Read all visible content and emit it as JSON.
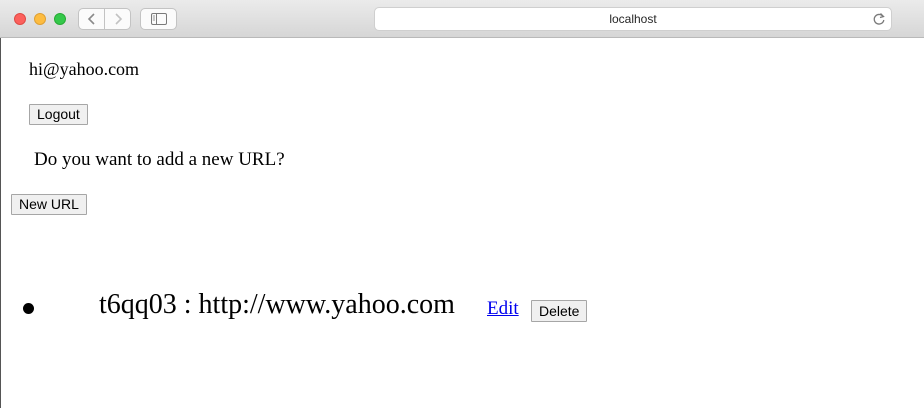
{
  "browser": {
    "address": "localhost",
    "icons": {
      "back": "chevron-left-icon",
      "forward": "chevron-right-icon",
      "sidebar": "sidebar-icon",
      "reload": "reload-icon"
    }
  },
  "user": {
    "email": "hi@yahoo.com",
    "logout_label": "Logout"
  },
  "prompt": {
    "question": "Do you want to add a new URL?",
    "new_url_label": "New URL"
  },
  "urls": [
    {
      "text": "t6qq03 : http://www.yahoo.com",
      "edit_label": "Edit",
      "delete_label": "Delete"
    }
  ],
  "colors": {
    "link": "#0000ee",
    "button_bg": "#f0f0f0"
  }
}
